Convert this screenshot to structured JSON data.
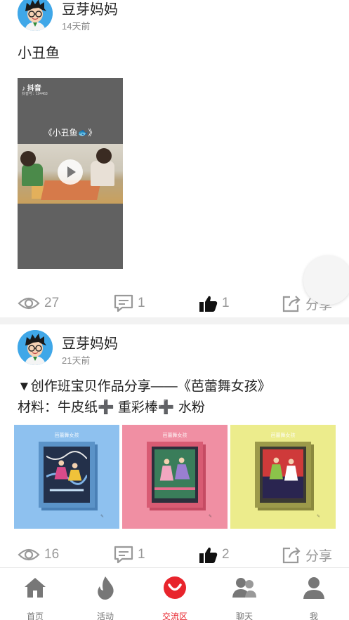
{
  "posts": [
    {
      "author": "豆芽妈妈",
      "time": "14天前",
      "content": "小丑鱼",
      "video": {
        "platform": "抖音",
        "platform_id": "抖音号：104463",
        "title": "《小丑鱼🐟》"
      },
      "views": "27",
      "comments": "1",
      "likes": "1",
      "share_label": "分享"
    },
    {
      "author": "豆芽妈妈",
      "time": "21天前",
      "content_line1": "▼创作班宝贝作品分享——《芭蕾舞女孩》",
      "content_line2": "材料：牛皮纸➕ 重彩棒➕ 水粉",
      "images": [
        {
          "caption": "芭蕾舞女孩",
          "color": "#8ec1ef"
        },
        {
          "caption": "芭蕾舞女孩",
          "color": "#f08fa3"
        },
        {
          "caption": "芭蕾舞女孩",
          "color": "#ecec8c"
        }
      ],
      "views": "16",
      "comments": "1",
      "likes": "2",
      "share_label": "分享"
    }
  ],
  "tabbar": {
    "items": [
      {
        "label": "首页",
        "icon": "home-icon"
      },
      {
        "label": "活动",
        "icon": "flame-icon"
      },
      {
        "label": "交流区",
        "icon": "smile-icon",
        "active": true
      },
      {
        "label": "聊天",
        "icon": "people-icon"
      },
      {
        "label": "我",
        "icon": "user-icon"
      }
    ]
  },
  "colors": {
    "accent": "#e8242c",
    "muted": "#999999",
    "divider": "#f2f2f2"
  }
}
